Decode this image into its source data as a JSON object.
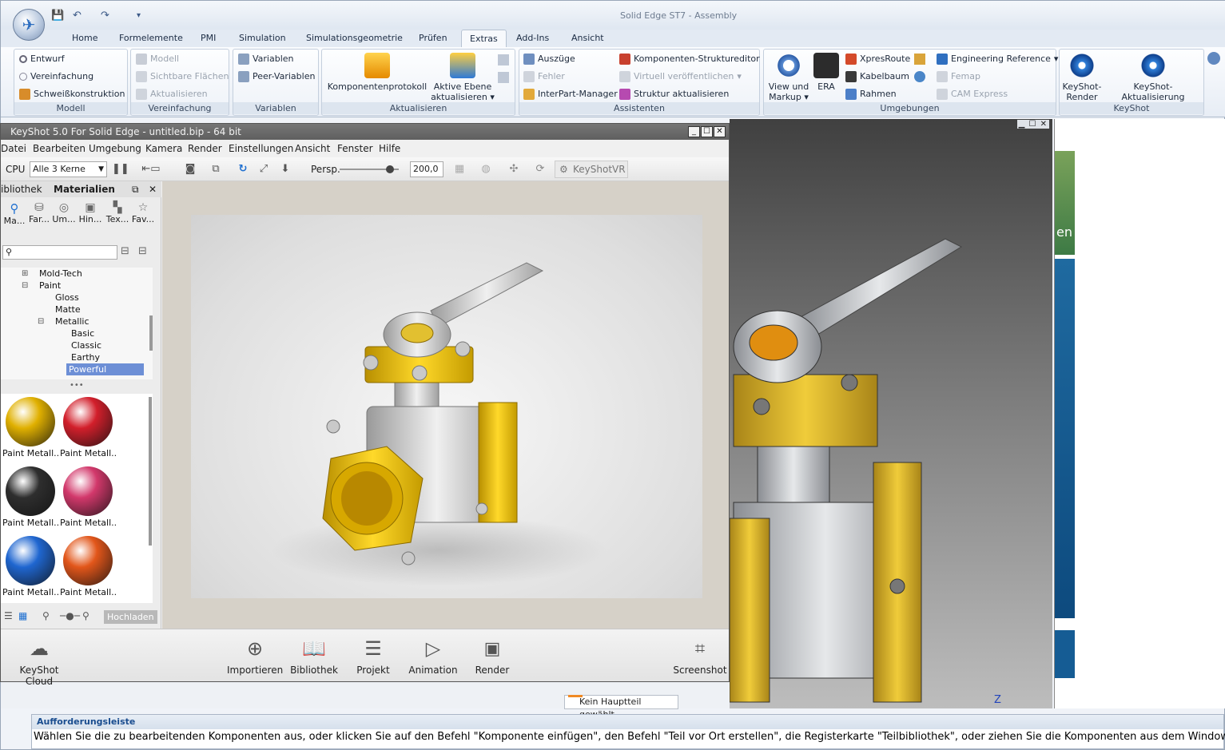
{
  "app": {
    "window_title": "Solid Edge ST7 - Assembly",
    "orb_icon": "solid-edge-logo-icon",
    "quick_access": [
      "save-icon",
      "undo-icon",
      "redo-icon",
      "customize-qat-icon"
    ]
  },
  "tabs": [
    {
      "label": "Home"
    },
    {
      "label": "Formelemente"
    },
    {
      "label": "PMI"
    },
    {
      "label": "Simulation"
    },
    {
      "label": "Simulationsgeometrie"
    },
    {
      "label": "Prüfen"
    },
    {
      "label": "Extras",
      "active": true
    },
    {
      "label": "Add-Ins"
    },
    {
      "label": "Ansicht"
    }
  ],
  "ribbon": {
    "modell": {
      "label": "Modell",
      "items": [
        "Entwurf",
        "Vereinfachung",
        "Schweißkonstruktion"
      ]
    },
    "vereinfachung": {
      "label": "Vereinfachung",
      "items": [
        "Modell",
        "Sichtbare Flächen",
        "Aktualisieren"
      ]
    },
    "variablen": {
      "label": "Variablen",
      "items": [
        "Variablen",
        "Peer-Variablen"
      ]
    },
    "aktualisieren": {
      "label": "Aktualisieren",
      "komponentenprotokoll": "Komponentenprotokoll",
      "aktive_ebene_1": "Aktive Ebene",
      "aktive_ebene_2": "aktualisieren"
    },
    "assistenten": {
      "label": "Assistenten",
      "col1": [
        "Auszüge",
        "Fehler",
        "InterPart-Manager"
      ],
      "col2": [
        "Komponenten-Struktureditor",
        "Virtuell veröffentlichen",
        "Struktur aktualisieren"
      ]
    },
    "umgebungen": {
      "label": "Umgebungen",
      "view_1": "View und",
      "view_2": "Markup",
      "era": "ERA",
      "col1": [
        "XpresRoute",
        "Kabelbaum",
        "Rahmen"
      ],
      "col2": [
        "Engineering Reference",
        "Femap",
        "CAM Express"
      ]
    },
    "keyshot": {
      "label": "KeyShot",
      "render_1": "KeyShot-",
      "render_2": "Render",
      "update": "KeyShot-Aktualisierung"
    }
  },
  "keyshot": {
    "title": "KeyShot 5.0 For Solid Edge - untitled.bip  - 64 bit",
    "menu": [
      "Datei",
      "Bearbeiten",
      "Umgebung",
      "Kamera",
      "Render",
      "Einstellungen",
      "Ansicht",
      "Fenster",
      "Hilfe"
    ],
    "toolbar": {
      "cpu_label": "CPU",
      "cpu_value": "Alle 3 Kerne",
      "persp_label": "Persp.",
      "persp_value": "200,0",
      "vr_label": "KeyShotVR",
      "slider_fraction": 0.85
    },
    "panel_tabs": [
      "ibliothek",
      "Materialien"
    ],
    "library_tabs": [
      "Ma...",
      "Far...",
      "Um...",
      "Hin...",
      "Tex...",
      "Fav..."
    ],
    "tree": [
      {
        "label": "Mold-Tech",
        "indent": 1,
        "toggle": "+"
      },
      {
        "label": "Paint",
        "indent": 1,
        "toggle": "−"
      },
      {
        "label": "Gloss",
        "indent": 2
      },
      {
        "label": "Matte",
        "indent": 2
      },
      {
        "label": "Metallic",
        "indent": 2,
        "toggle": "−"
      },
      {
        "label": "Basic",
        "indent": 3
      },
      {
        "label": "Classic",
        "indent": 3
      },
      {
        "label": "Earthy",
        "indent": 3
      },
      {
        "label": "Powerful",
        "indent": 3,
        "selected": true
      }
    ],
    "materials": [
      {
        "label": "Paint Metall...",
        "color": "#e0b000"
      },
      {
        "label": "Paint Metall...",
        "color": "#d21f2b"
      },
      {
        "label": "Paint Metall...",
        "color": "#2e2e2e"
      },
      {
        "label": "Paint Metall...",
        "color": "#d2386b"
      },
      {
        "label": "Paint Metall...",
        "color": "#1f66d0"
      },
      {
        "label": "Paint Metall...",
        "color": "#e2561a"
      }
    ],
    "upload_label": "Hochladen",
    "bottom": {
      "cloud": "KeyShot Cloud",
      "import": "Importieren",
      "library": "Bibliothek",
      "project": "Projekt",
      "animation": "Animation",
      "render": "Render",
      "screenshot": "Screenshot"
    }
  },
  "se": {
    "status_msg": "Kein Hauptteil gewählt.",
    "z_label": "Z",
    "prompt_title": "Aufforderungsleiste",
    "prompt_text": "Wählen Sie die zu bearbeitenden Komponenten aus, oder klicken Sie auf den Befehl \"Komponente einfügen\", den Befehl \"Teil vor Ort erstellen\", die Registerkarte \"Teilbibliothek\", oder ziehen Sie die Komponenten aus dem Windows Explorer.",
    "right_panel_text": "en"
  },
  "colors": {
    "accent": "#2f6fc0",
    "ks_title": "#666666",
    "valve_yellow": "#e6b800",
    "selection": "#6d8fd6"
  }
}
